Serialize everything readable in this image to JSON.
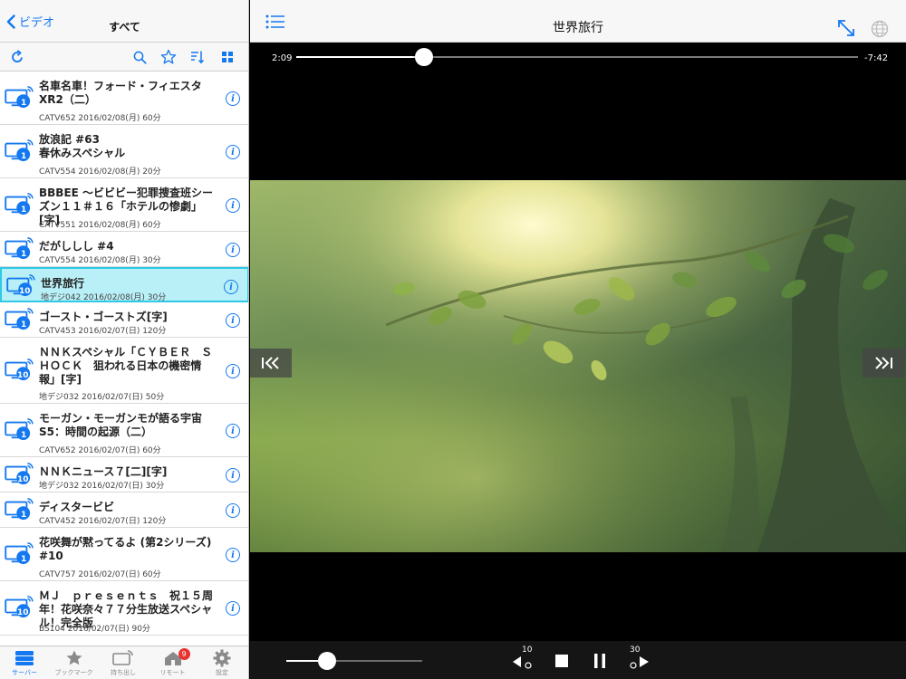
{
  "left_nav": {
    "back_label": "ビデオ",
    "title": "すべて"
  },
  "colors": {
    "accent": "#1478f0",
    "selected_bg": "#b9f0f7",
    "selected_border": "#2ec9e6",
    "badge": "#e8322f"
  },
  "recordings": [
    {
      "badge": "1",
      "title": "名車名車！フォード・フィエスタ\nXR2（二）",
      "sub": "CATV652  2016/02/08(月)  60分"
    },
    {
      "badge": "1",
      "title": "放浪記 #63\n春休みスペシャル",
      "sub": "CATV554  2016/02/08(月)  20分"
    },
    {
      "badge": "1",
      "title": "BBBEE 〜ビビビー犯罪捜査班シー\nズン１１＃１６「ホテルの惨劇」[字]",
      "sub": "CATV551  2016/02/08(月)  60分"
    },
    {
      "badge": "1",
      "title": "だがししし #4",
      "sub": "CATV554  2016/02/08(月)  30分"
    },
    {
      "badge": "10",
      "title": "世界旅行",
      "sub": "地デジ042  2016/02/08(月)  30分",
      "selected": true
    },
    {
      "badge": "1",
      "title": "ゴースト・ゴーストズ[字]",
      "sub": "CATV453  2016/02/07(日)  120分"
    },
    {
      "badge": "10",
      "title": "ＮＮＫスペシャル「ＣＹＢＥＲ　Ｓ\nＨＯＣＫ　狙われる日本の機密情\n報」[字]",
      "sub": "地デジ032  2016/02/07(日)  50分"
    },
    {
      "badge": "1",
      "title": "モーガン・モーガンモが語る宇宙\nS5：時間の起源（二）",
      "sub": "CATV652  2016/02/07(日)  60分"
    },
    {
      "badge": "10",
      "title": "ＮＮＫニュース７[二][字]",
      "sub": "地デジ032  2016/02/07(日)  30分"
    },
    {
      "badge": "1",
      "title": "ディスタービビ",
      "sub": "CATV452  2016/02/07(日)  120分"
    },
    {
      "badge": "1",
      "title": "花咲舞が黙ってるよ (第2シリーズ)\n#10",
      "sub": "CATV757  2016/02/07(日)  60分"
    },
    {
      "badge": "10",
      "title": "ＭＪ　ｐｒｅｓｅｎｔｓ　祝１５周\n年！花咲奈々７７分生放送スペシャ\nル！完全版",
      "sub": "BS104  2016/02/07(日)  90分"
    }
  ],
  "tabs": [
    {
      "label": "サーバー",
      "icon": "server-icon",
      "active": true
    },
    {
      "label": "ブックマーク",
      "icon": "star-icon"
    },
    {
      "label": "持ち出し",
      "icon": "takeout-tv-icon"
    },
    {
      "label": "リモート",
      "icon": "remote-home-icon",
      "badge": "9"
    },
    {
      "label": "設定",
      "icon": "gear-icon"
    }
  ],
  "player": {
    "title": "世界旅行",
    "elapsed": "2:09",
    "remaining": "-7:42",
    "progress": 0.228,
    "volume": 0.3,
    "skip_back_seconds": "10",
    "skip_forward_seconds": "30"
  }
}
